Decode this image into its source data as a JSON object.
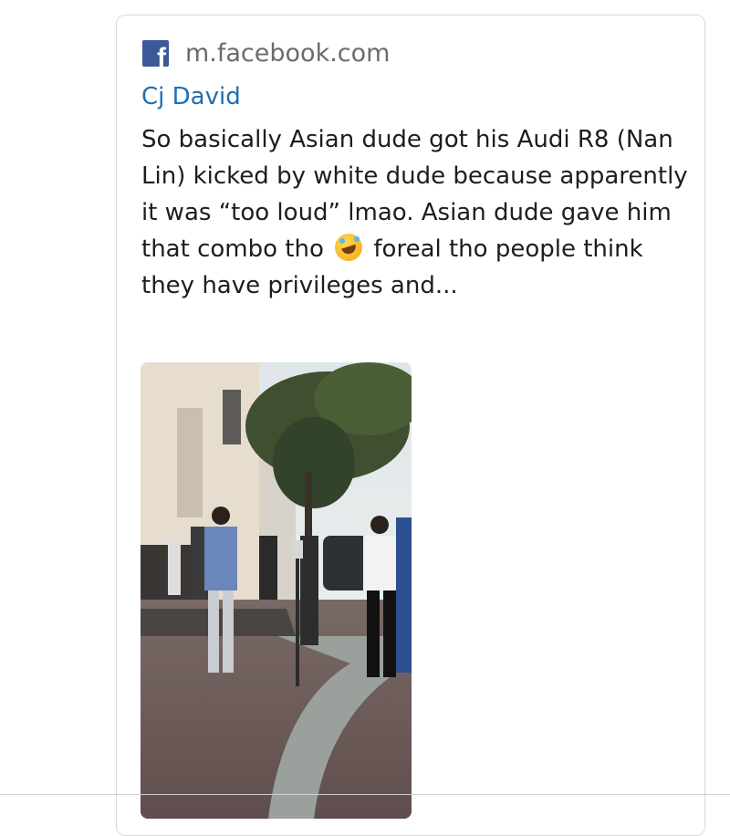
{
  "link_card": {
    "source_icon": "facebook-icon",
    "source_icon_glyph": "f",
    "source_domain": "m.facebook.com",
    "author": "Cj David",
    "text_before_emoji": "So basically Asian dude got his Audi R8 (Nan Lin) kicked by white dude because apparently it was “too loud” lmao. Asian dude gave him that combo tho",
    "emoji": "rolling-on-floor-laughing-emoji",
    "text_after_emoji": "foreal tho people think they have privileges and...",
    "media": "video-thumbnail"
  },
  "colors": {
    "facebook_brand": "#3b5998",
    "author_link": "#1f6fb2",
    "card_border": "#d9d9d9"
  }
}
